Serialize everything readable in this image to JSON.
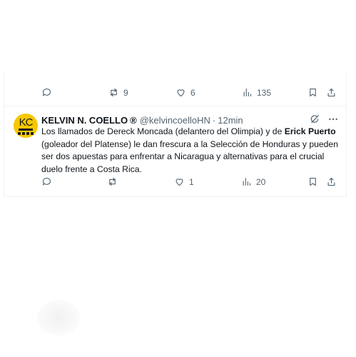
{
  "prev_tweet": {
    "retweets": "9",
    "likes": "6",
    "views": "135"
  },
  "tweet": {
    "author_name": "KELVIN N. COELLO",
    "badge": "®",
    "handle": "@kelvincoelloHN",
    "separator": "·",
    "time": "12min",
    "avatar_text": "KC",
    "text_part1": "Los llamados de Dereck Moncada (delantero del Olimpia) y de ",
    "text_bold": "Erick Puerto",
    "text_part2": " (goleador del Platense) le dan frescura a la Selección de Honduras y pueden ser dos apuestas para enfrentar a Nicaragua y alternativas para el crucial duelo frente a Costa Rica.",
    "replies": "",
    "retweets": "",
    "likes": "1",
    "views": "20"
  },
  "icons": [
    "reply-icon",
    "retweet-icon",
    "like-icon",
    "views-icon",
    "bookmark-icon",
    "share-icon",
    "grok-icon",
    "more-icon"
  ],
  "colors": {
    "muted": "#536471",
    "text": "#0f1419",
    "avatar_bg": "#f6c800",
    "border": "#eff3f4"
  }
}
